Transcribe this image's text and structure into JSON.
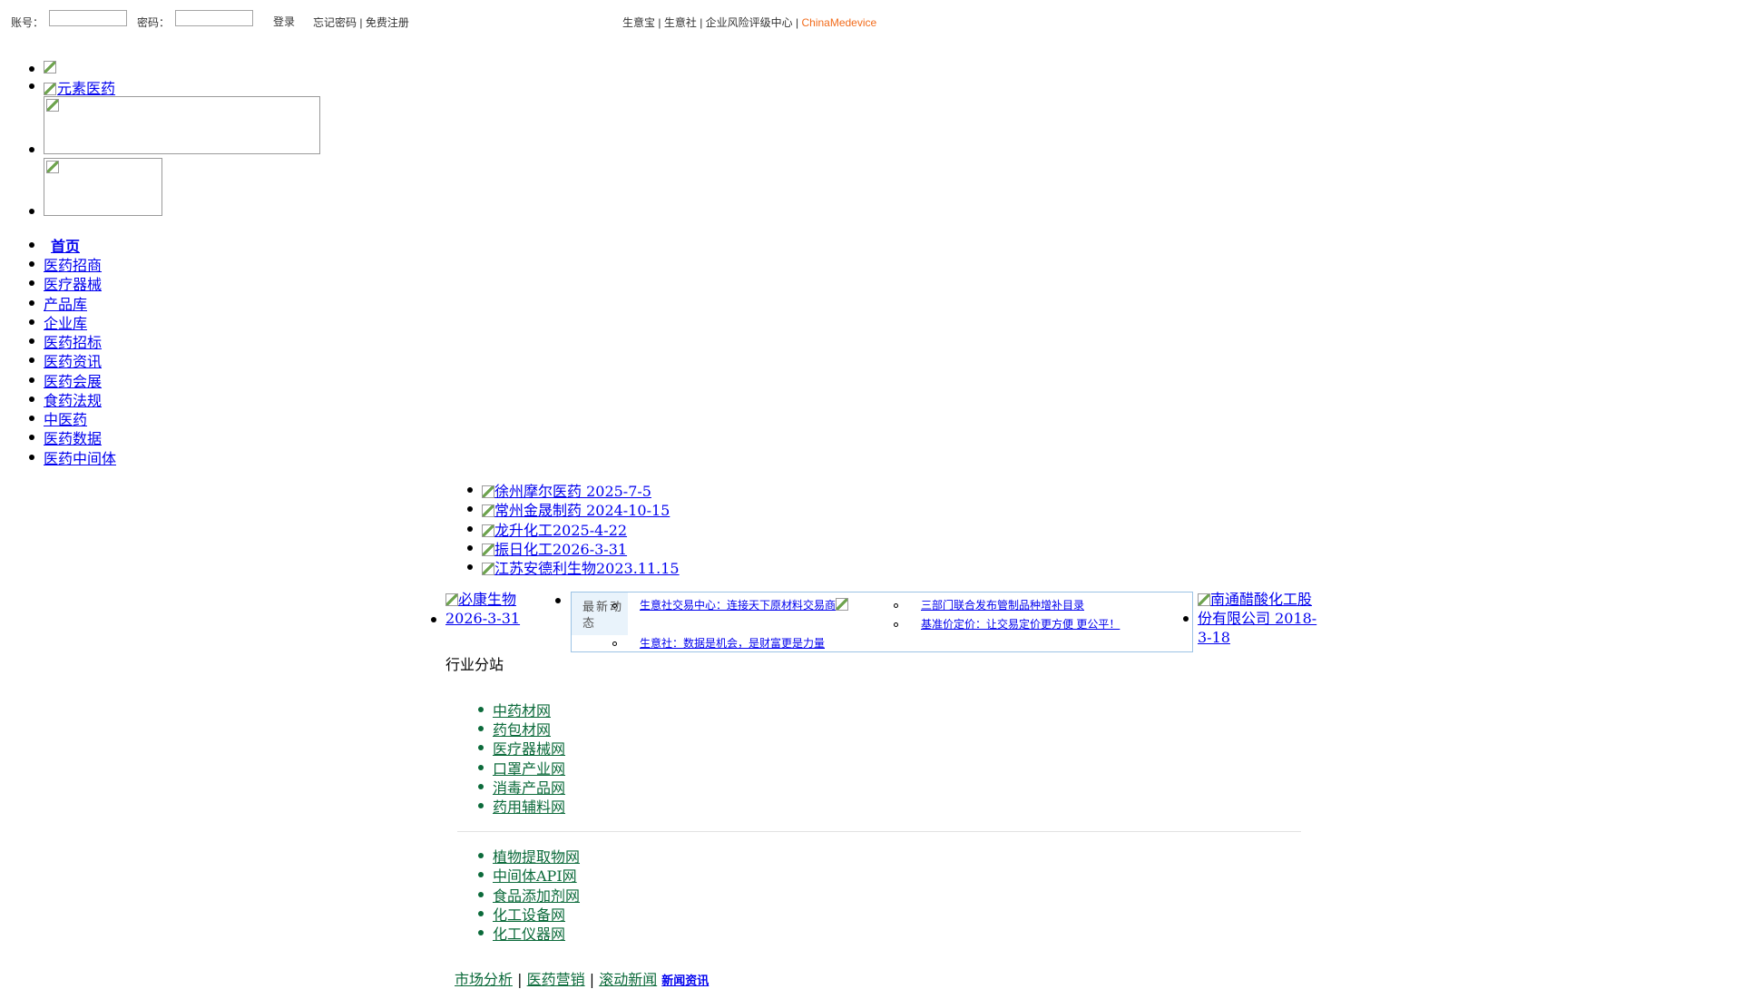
{
  "topbar": {
    "account_label": "账号：",
    "password_label": "密码：",
    "account_value": "",
    "password_value": "",
    "login_label": "登录",
    "forgot_label": "忘记密码",
    "register_label": "免费注册",
    "sep": "|",
    "links": [
      "生意宝",
      "生意社",
      "企业风险评级中心"
    ],
    "brand_link": "ChinaMedevice"
  },
  "logo": {
    "alt": "元素医药"
  },
  "main_nav": [
    "首页",
    "医药招商",
    "医疗器械",
    "产品库",
    "企业库",
    "医药招标",
    "医药资讯",
    "医药会展",
    "食药法规",
    "中医药",
    "医药数据",
    "医药中间体"
  ],
  "ad_links": [
    "徐州摩尔医药 2025-7-5",
    "常州金晟制药 2024-10-15",
    "龙升化工2025-4-22",
    "振日化工2026-3-31",
    "江苏安德利生物2023.11.15"
  ],
  "left_ad": "必康生物2026-3-31",
  "right_ad": "南通醋酸化工股份有限公司 2018-3-18",
  "news": {
    "head": "最新动态",
    "items": [
      "生意社交易中心：连接天下原材料交易商",
      "三部门联合发布管制品种增补目录",
      "基准价定价：让交易定价更方便 更公平！",
      "生意社：数据是机会，是财富更是力量"
    ]
  },
  "industry": {
    "title": "行业分站",
    "group1": [
      "中药材网",
      "药包材网",
      "医疗器械网",
      "口罩产业网",
      "消毒产品网",
      "药用辅料网"
    ],
    "group2": [
      "植物提取物网",
      "中间体API网",
      "食品添加剂网",
      "化工设备网",
      "化工仪器网"
    ]
  },
  "tabs": {
    "items": [
      "市场分析",
      "医药营销",
      "滚动新闻"
    ],
    "active": "新闻资讯"
  },
  "colors": {
    "link": "#0000ee",
    "orange": "#f26c1c",
    "green": "#0b6a3a",
    "news_border": "#9cc3e5"
  }
}
